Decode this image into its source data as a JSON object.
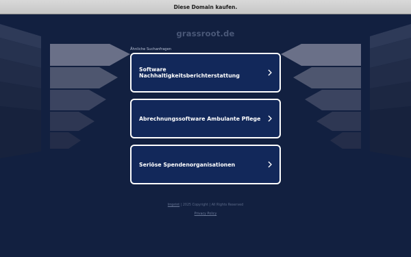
{
  "topbar": {
    "label": "Diese Domain kaufen."
  },
  "domain": "grassroot.de",
  "related_heading": "Ähnliche Suchanfragen",
  "links": [
    {
      "label": "Software Nachhaltigkeitsberichterstattung"
    },
    {
      "label": "Abrechnungssoftware Ambulante Pflege"
    },
    {
      "label": "Seriöse Spendenorganisationen"
    }
  ],
  "footer": {
    "imprint": "Imprint",
    "copyright": "| 2025 Copyright | All Rights Reserved",
    "privacy": "Privacy Policy"
  },
  "colors": {
    "background": "#122040",
    "box_fill": "#12285a",
    "box_border": "#ffffff",
    "topbar": "#d0d0d0"
  },
  "icons": [
    "chevron-right-icon"
  ]
}
